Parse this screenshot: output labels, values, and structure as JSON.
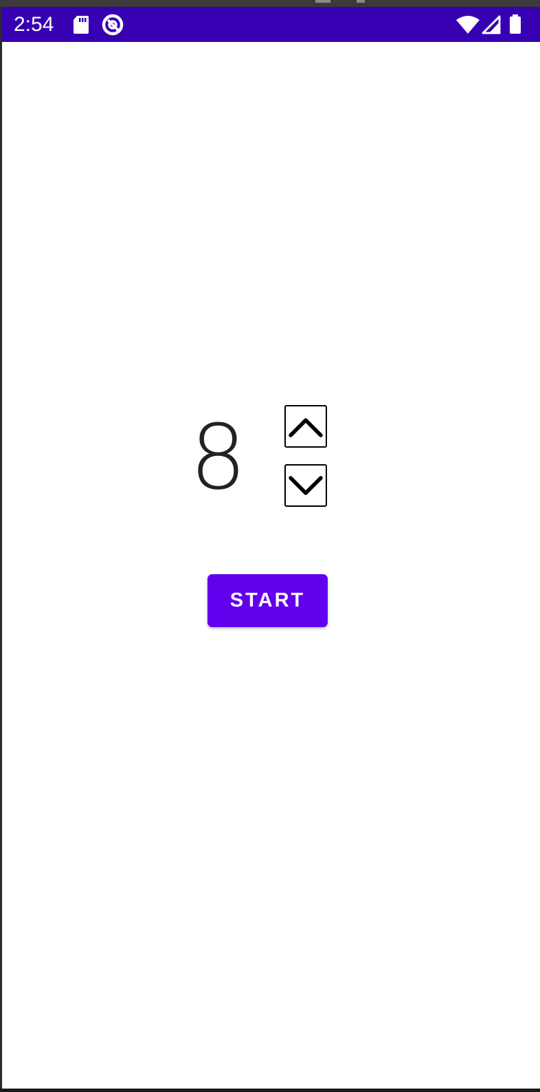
{
  "status_bar": {
    "time": "2:54",
    "background": "#3700b3",
    "icons": [
      "sd-card-icon",
      "data-saver-icon",
      "wifi-icon",
      "cell-signal-icon",
      "battery-icon"
    ]
  },
  "counter": {
    "value": "8",
    "increment_icon": "chevron-up-icon",
    "decrement_icon": "chevron-down-icon"
  },
  "start_button": {
    "label": "START",
    "color": "#6200ee"
  }
}
